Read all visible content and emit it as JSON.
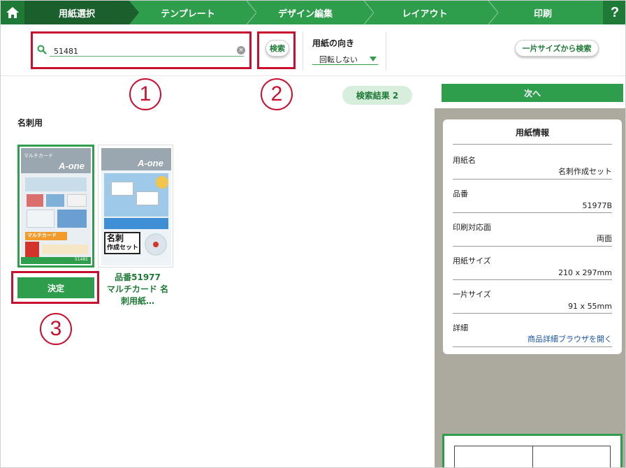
{
  "nav": {
    "steps": [
      "用紙選択",
      "テンプレート",
      "デザイン編集",
      "レイアウト",
      "印刷"
    ],
    "help": "?"
  },
  "toolbar": {
    "search_value": "51481",
    "search_button": "検索",
    "orientation_title": "用紙の向き",
    "orientation_value": "回転しない",
    "size_search_button": "一片サイズから検索"
  },
  "annotations": [
    "1",
    "2",
    "3"
  ],
  "results": {
    "count_label": "検索結果 2",
    "next_button": "次へ",
    "section_label": "名刺用",
    "decide_button": "決定",
    "item2_caption": [
      "品番51977",
      "マルチカード 名",
      "刺用紙…"
    ],
    "thumb1": {
      "brand": "A-one",
      "tag": "マルチカード",
      "banner": "マルチカード",
      "code": "51481"
    },
    "thumb2": {
      "brand": "A-one",
      "title_line1": "名刺",
      "title_line2": "作成セット"
    }
  },
  "info": {
    "title": "用紙情報",
    "rows": [
      {
        "key": "用紙名",
        "value": "名刺作成セット"
      },
      {
        "key": "品番",
        "value": "51977B"
      },
      {
        "key": "印刷対応面",
        "value": "両面"
      },
      {
        "key": "用紙サイズ",
        "value": "210 x 297mm"
      },
      {
        "key": "一片サイズ",
        "value": "91 x 55mm"
      },
      {
        "key": "詳細",
        "value": "商品詳細ブラウザを開く"
      }
    ]
  },
  "colors": {
    "brand_green": "#2e9e4d",
    "dark_green": "#1a5f2c",
    "annotation_red": "#c8102e",
    "panel_gray": "#aca99f"
  }
}
